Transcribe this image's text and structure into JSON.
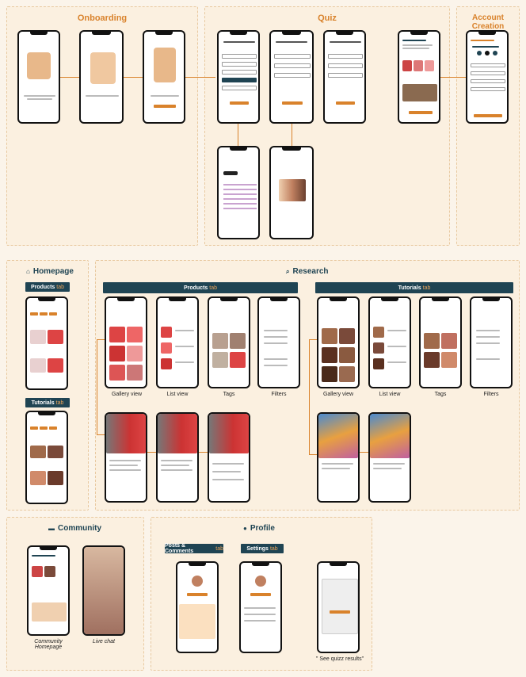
{
  "sections": {
    "onboarding": {
      "title": "Onboarding"
    },
    "quiz": {
      "title": "Quiz"
    },
    "account": {
      "title": "Account Creation"
    },
    "homepage": {
      "title": "Homepage",
      "products_tab": "Products",
      "tutorials_tab": "Tutorials",
      "tab_suffix": "tab"
    },
    "research": {
      "title": "Research",
      "products_tab": "Products",
      "tutorials_tab": "Tutorials",
      "tab_suffix": "tab",
      "captions": [
        "Gallery view",
        "List view",
        "Tags",
        "Filters"
      ]
    },
    "community": {
      "title": "Community",
      "captions": [
        "Community Homepage",
        "Live chat"
      ]
    },
    "profile": {
      "title": "Profile",
      "posts_tab": "Posts & Comments",
      "settings_tab": "Settings",
      "tab_suffix": "tab",
      "see_quiz": "\" See quizz results\""
    }
  },
  "colors": {
    "accent": "#d9822b",
    "dark": "#1f4453"
  },
  "icons": {
    "homepage": "home-icon",
    "research": "search-icon",
    "community": "chat-icon",
    "profile": "user-icon"
  }
}
